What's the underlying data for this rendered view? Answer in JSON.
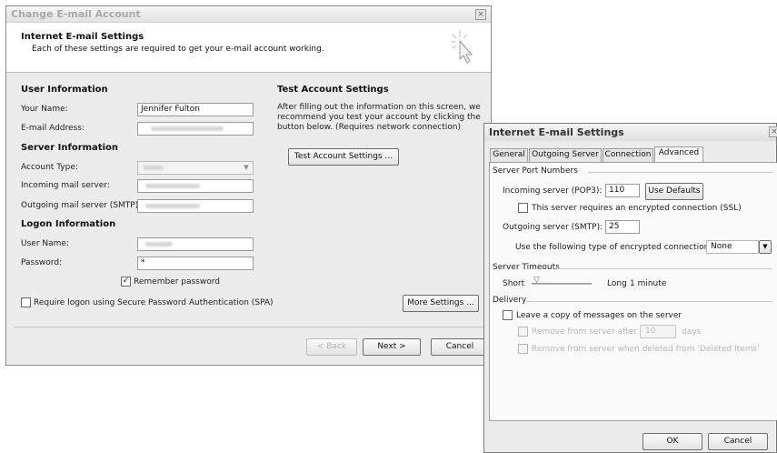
{
  "main_dialog": {
    "title": "Change E-mail Account",
    "header_title": "Internet E-mail Settings",
    "header_subtitle": "Each of these settings are required to get your e-mail account working.",
    "user_info": {
      "section": "User Information",
      "name_label": "Your Name:",
      "name_value": "Jennifer Fulton",
      "email_label": "E-mail Address:"
    },
    "server_info": {
      "section": "Server Information",
      "account_type_label": "Account Type:",
      "incoming_label": "Incoming mail server:",
      "outgoing_label": "Outgoing mail server (SMTP):"
    },
    "logon_info": {
      "section": "Logon Information",
      "username_label": "User Name:",
      "password_label": "Password:",
      "password_value": "*",
      "remember_label": "Remember password",
      "spa_label": "Require logon using Secure Password Authentication (SPA)"
    },
    "test": {
      "section": "Test Account Settings",
      "description_line1": "After filling out the information on this screen, we",
      "description_line2": "recommend you test your account by clicking the",
      "description_line3": "button below. (Requires network connection)",
      "button": "Test Account Settings ..."
    },
    "more_settings_button": "More Settings ...",
    "back_button": "< Back",
    "next_button": "Next >",
    "cancel_button": "Cancel"
  },
  "settings_dialog": {
    "title": "Internet E-mail Settings",
    "tabs": [
      "General",
      "Outgoing Server",
      "Connection",
      "Advanced"
    ],
    "server_ports": {
      "group": "Server Port Numbers",
      "incoming_label": "Incoming server (POP3):",
      "incoming_value": "110",
      "use_defaults_button": "Use Defaults",
      "ssl_label": "This server requires an encrypted connection (SSL)",
      "outgoing_label": "Outgoing server (SMTP):",
      "outgoing_value": "25",
      "encryption_label": "Use the following type of encrypted connection:",
      "encryption_value": "None"
    },
    "timeouts": {
      "group": "Server Timeouts",
      "short_label": "Short",
      "long_label": "Long",
      "value": "1 minute"
    },
    "delivery": {
      "group": "Delivery",
      "leave_copy_label": "Leave a copy of messages on the server",
      "remove_after_label": "Remove from server after",
      "remove_after_value": "10",
      "days_label": "days",
      "remove_deleted_label": "Remove from server when deleted from 'Deleted Items'"
    },
    "ok_button": "OK",
    "cancel_button": "Cancel"
  }
}
